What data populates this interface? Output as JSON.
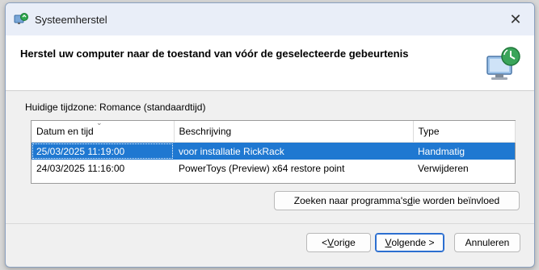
{
  "window": {
    "title": "Systeemherstel",
    "close_glyph": "✕"
  },
  "header": {
    "heading": "Herstel uw computer naar de toestand van vóór de geselecteerde gebeurtenis"
  },
  "timezone_label": "Huidige tijdzone: Romance (standaardtijd)",
  "table": {
    "columns": [
      "Datum en tijd",
      "Beschrijving",
      "Type"
    ],
    "rows": [
      {
        "date": "25/03/2025 11:19:00",
        "description": "voor installatie RickRack",
        "type": "Handmatig",
        "selected": true
      },
      {
        "date": "24/03/2025 11:16:00",
        "description": "PowerToys (Preview) x64 restore point",
        "type": "Verwijderen",
        "selected": false
      }
    ]
  },
  "buttons": {
    "scan_pre": "Zoeken naar programma's ",
    "scan_u": "d",
    "scan_post": "ie worden beïnvloed",
    "back_pre": "< ",
    "back_u": "V",
    "back_post": "orige",
    "next_u": "V",
    "next_post": "olgende >",
    "cancel": "Annuleren"
  },
  "colors": {
    "selection": "#1f78d1",
    "accent": "#2c6fd0"
  },
  "icons": [
    "system-restore-icon",
    "close-icon",
    "restore-computer-icon",
    "sort-caret-icon"
  ]
}
